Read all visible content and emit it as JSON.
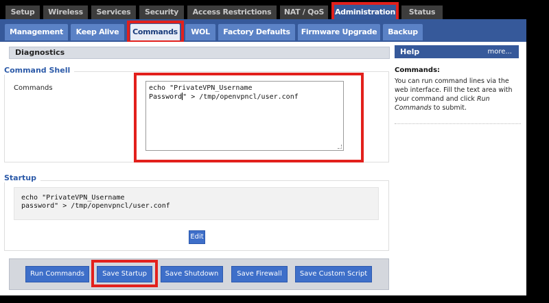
{
  "top_tabs": [
    "Setup",
    "Wireless",
    "Services",
    "Security",
    "Access Restrictions",
    "NAT / QoS",
    "Administration",
    "Status"
  ],
  "sub_tabs": [
    "Management",
    "Keep Alive",
    "Commands",
    "WOL",
    "Factory Defaults",
    "Firmware Upgrade",
    "Backup"
  ],
  "section": {
    "title": "Diagnostics"
  },
  "command_shell": {
    "legend": "Command Shell",
    "field_label": "Commands",
    "line1": "echo \"PrivateVPN_Username",
    "line2_a": "Password",
    "line2_b": "\" > /tmp/openvpncl/user.conf"
  },
  "startup": {
    "legend": "Startup",
    "text": "echo \"PrivateVPN_Username\npassword\" > /tmp/openvpncl/user.conf",
    "edit_label": "Edit"
  },
  "buttons": {
    "run": "Run Commands",
    "save_startup": "Save Startup",
    "save_shutdown": "Save Shutdown",
    "save_firewall": "Save Firewall",
    "save_custom": "Save Custom Script"
  },
  "help": {
    "heading": "Help",
    "more": "more...",
    "title": "Commands:",
    "text_a": "You can run command lines via the web interface. Fill the text area with your command and click ",
    "text_em": "Run Commands",
    "text_b": " to submit."
  },
  "colors": {
    "accent": "#36599a",
    "highlight": "#e2201c"
  }
}
